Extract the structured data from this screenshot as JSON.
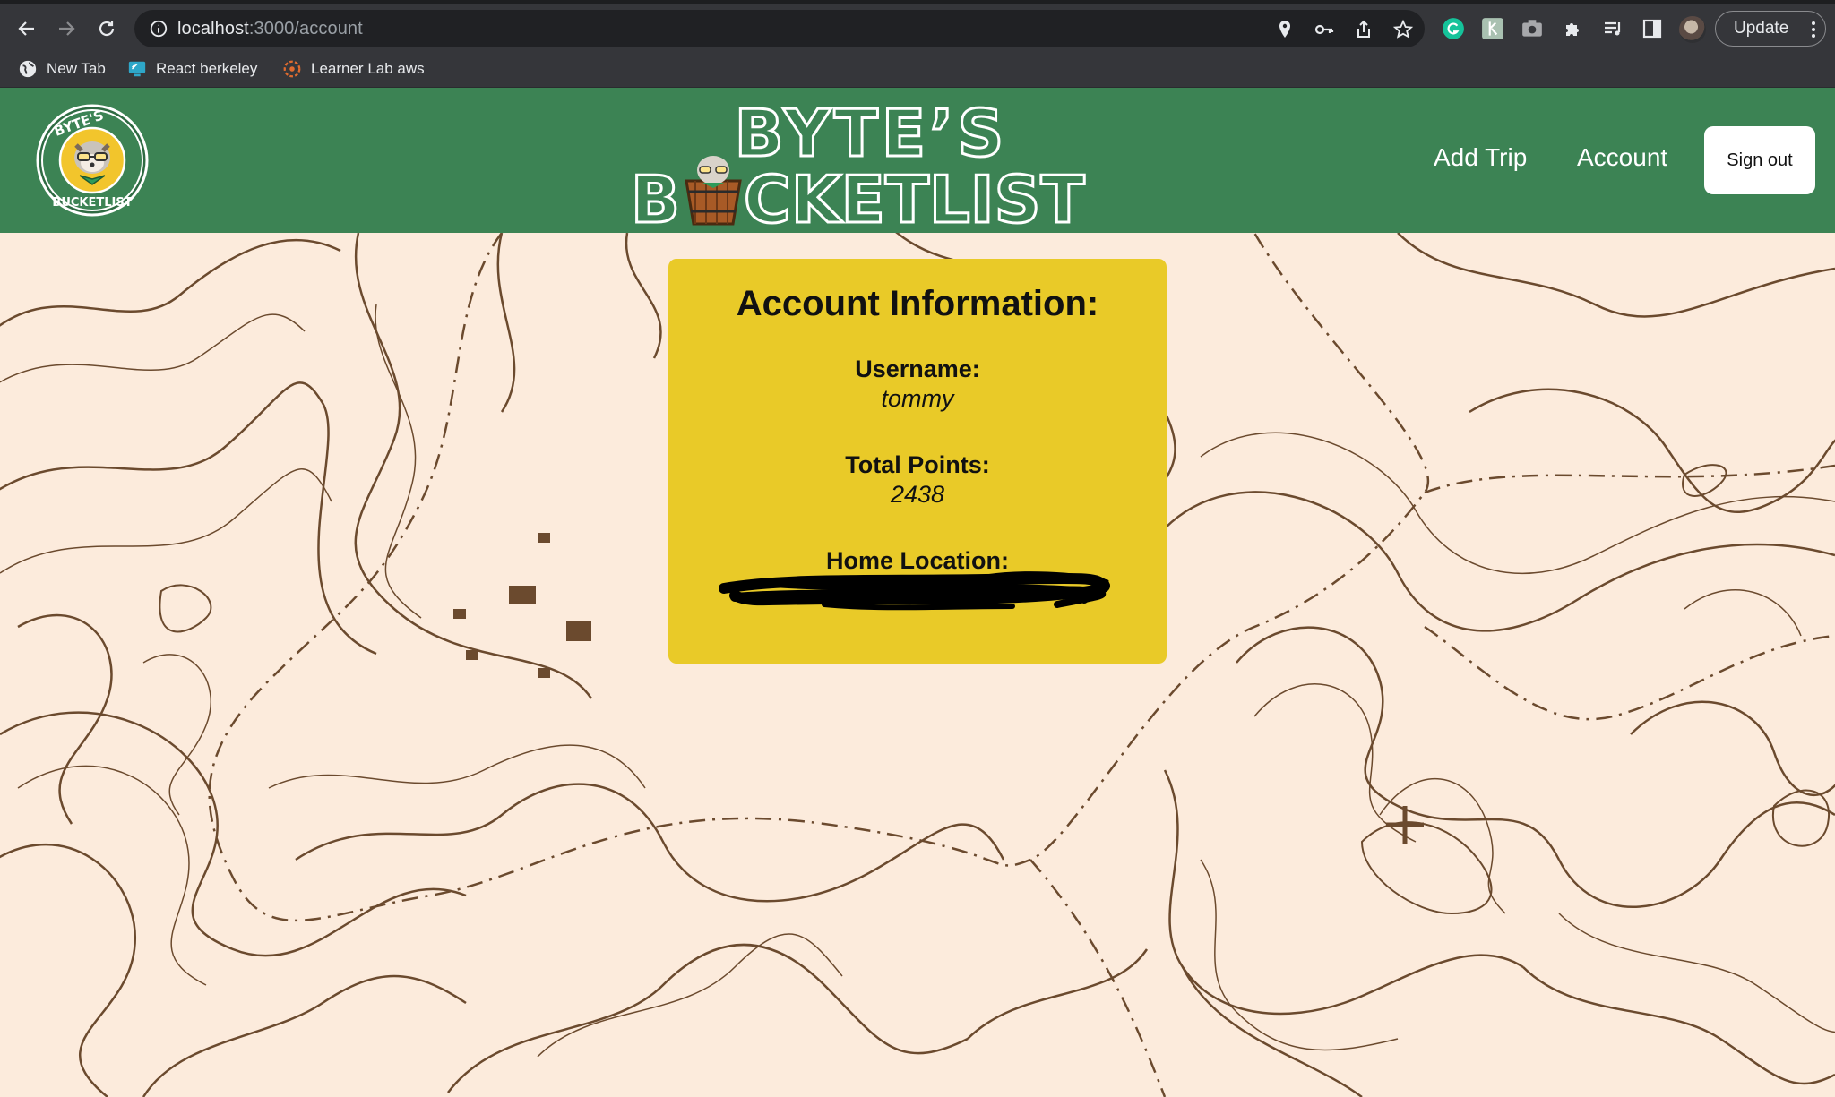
{
  "browser": {
    "url_host": "localhost",
    "url_path": ":3000/account",
    "update_label": "Update",
    "bookmarks": [
      {
        "label": "New Tab",
        "icon": "globe-icon"
      },
      {
        "label": "React berkeley",
        "icon": "monitor-icon"
      },
      {
        "label": "Learner Lab aws",
        "icon": "aws-icon"
      }
    ]
  },
  "header": {
    "logo_text": "BYTE'S BUCKETLIST",
    "brand_line1": "BYTE’S",
    "brand_line2_left": "B",
    "brand_line2_right": "CKETLIST",
    "nav": {
      "add_trip": "Add Trip",
      "account": "Account",
      "sign_out": "Sign out"
    },
    "colors": {
      "header_bg": "#3c8354",
      "card_bg": "#e9ca28",
      "page_bg": "#fcebdc"
    }
  },
  "account": {
    "title": "Account Information:",
    "username_label": "Username:",
    "username": "tommy",
    "points_label": "Total Points:",
    "points": "2438",
    "home_label": "Home Location:"
  }
}
